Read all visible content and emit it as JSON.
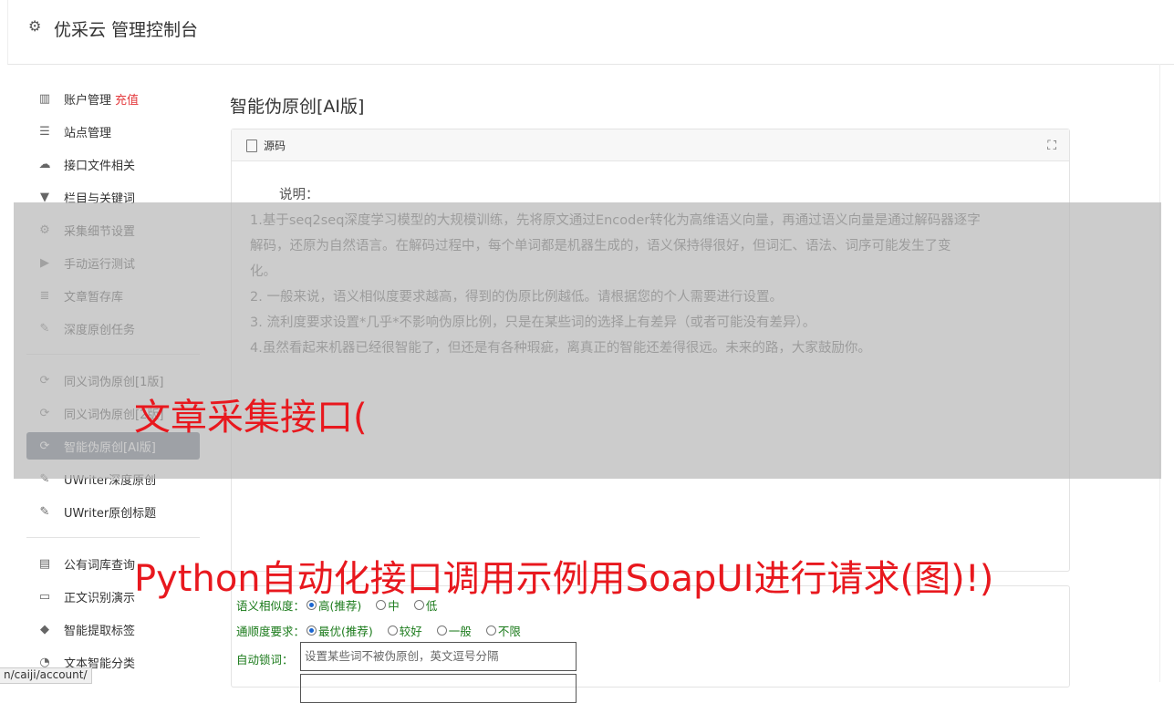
{
  "header": {
    "title": "优采云 管理控制台"
  },
  "sidebar": {
    "group1": [
      {
        "label": "账户管理",
        "badge": "充值",
        "icon": "bar-chart-icon"
      },
      {
        "label": "站点管理",
        "icon": "list-icon"
      },
      {
        "label": "接口文件相关",
        "icon": "cloud-upload-icon"
      },
      {
        "label": "栏目与关键词",
        "icon": "filter-icon"
      },
      {
        "label": "采集细节设置",
        "icon": "gears-icon"
      },
      {
        "label": "手动运行测试",
        "icon": "play-circle-icon"
      },
      {
        "label": "文章暂存库",
        "icon": "database-icon"
      },
      {
        "label": "深度原创任务",
        "icon": "edit-icon"
      }
    ],
    "group2": [
      {
        "label": "同义词伪原创[1版]",
        "icon": "refresh-icon"
      },
      {
        "label": "同义词伪原创[2版]",
        "icon": "refresh-icon"
      },
      {
        "label": "智能伪原创[AI版]",
        "icon": "refresh-icon",
        "active": true
      },
      {
        "label": "UWriter深度原创",
        "icon": "edit-icon"
      },
      {
        "label": "UWriter原创标题",
        "icon": "edit-icon"
      }
    ],
    "group3": [
      {
        "label": "公有词库查询",
        "icon": "book-icon"
      },
      {
        "label": "正文识别演示",
        "icon": "monitor-icon"
      },
      {
        "label": "智能提取标签",
        "icon": "tag-icon"
      },
      {
        "label": "文本智能分类",
        "icon": "pie-chart-icon"
      }
    ]
  },
  "main": {
    "title": "智能伪原创[AI版]",
    "panel_label": "源码",
    "desc_head": "说明：",
    "desc_lines": [
      "1.基于seq2seq深度学习模型的大规模训练，先将原文通过Encoder转化为高维语义向量，再通过语义向量是通过解码器逐字",
      "解码，还原为自然语言。在解码过程中，每个单词都是机器生成的，语义保持得很好，但词汇、语法、词序可能发生了变",
      "化。",
      "2. 一般来说，语义相似度要求越高，得到的伪原比例越低。请根据您的个人需要进行设置。",
      "3. 流利度要求设置*几乎*不影响伪原比例，只是在某些词的选择上有差异（或者可能没有差异）。",
      "4.虽然看起来机器已经很智能了，但还是有各种瑕疵，离真正的智能还差得很远。未来的路，大家鼓励你。"
    ]
  },
  "form": {
    "similarity": {
      "label": "语义相似度：",
      "options": [
        "高(推荐)",
        "中",
        "低"
      ],
      "selected": 0
    },
    "fluency": {
      "label": "通顺度要求：",
      "options": [
        "最优(推荐)",
        "较好",
        "一般",
        "不限"
      ],
      "selected": 0
    },
    "autolock": {
      "label": "自动锁词：",
      "placeholder": "设置某些词不被伪原创，英文逗号分隔"
    }
  },
  "watermarks": [
    "文章采集接口(",
    "Python自动化接口调用示例用SoapUI进行请求(图)!)"
  ],
  "statusbar": "n/caiji/account/"
}
